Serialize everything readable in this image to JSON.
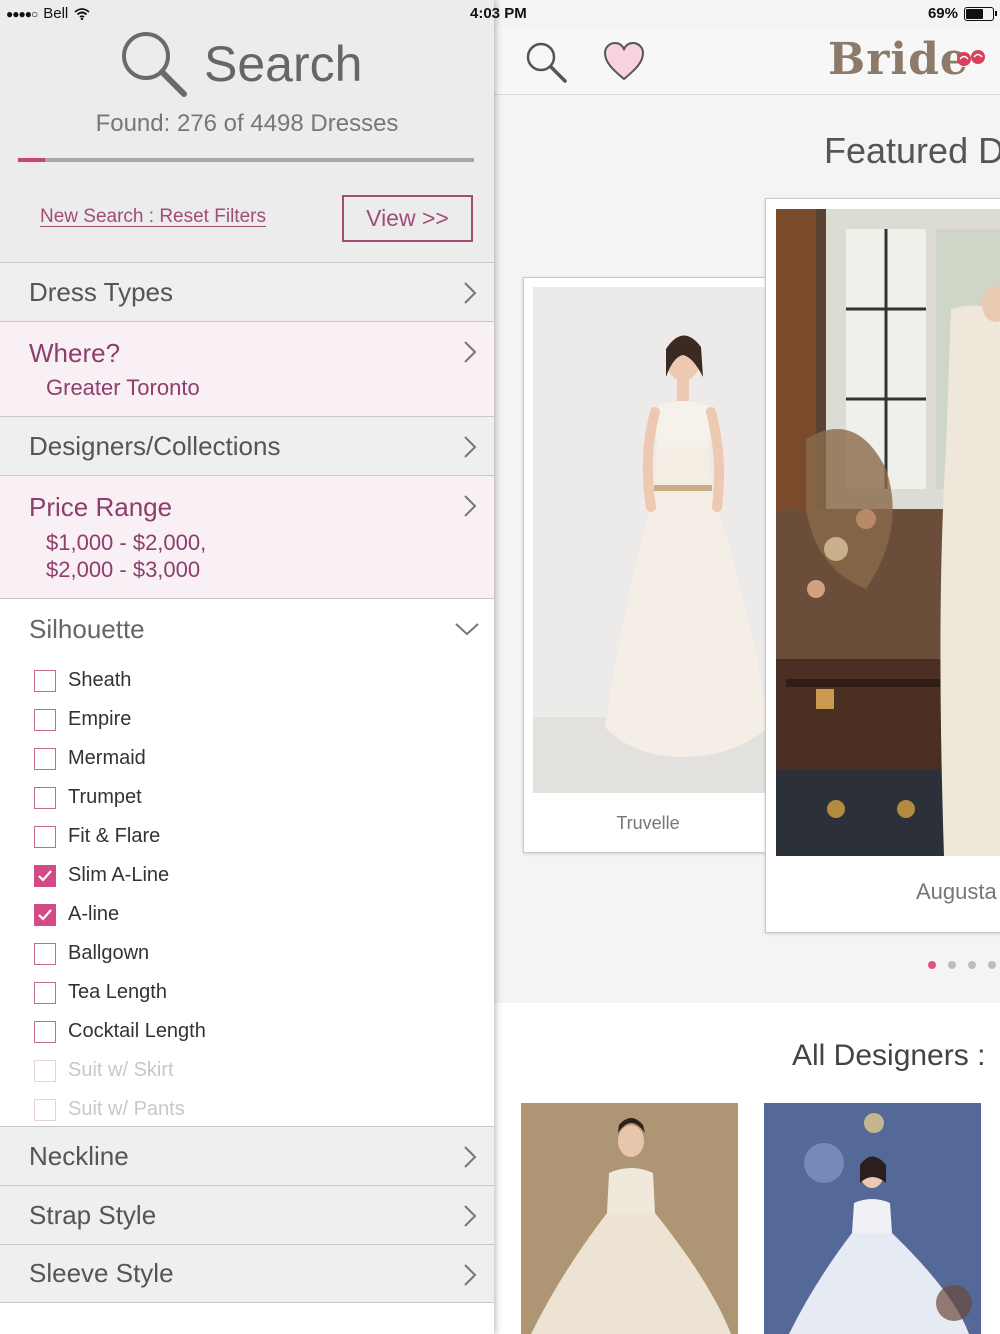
{
  "status_bar": {
    "signal_dots": "●●●●○",
    "carrier": "Bell",
    "time": "4:03 PM",
    "battery_text": "69%",
    "battery_level": 0.69
  },
  "search_panel": {
    "title": "Search",
    "found_text": "Found: 276 of 4498 Dresses",
    "progress": 0.06,
    "new_search_link": "New Search : Reset Filters",
    "view_button": "View >>",
    "filters": {
      "dress_types": "Dress Types",
      "where_label": "Where?",
      "where_value": "Greater Toronto",
      "designers": "Designers/Collections",
      "price_label": "Price Range",
      "price_value_1": "$1,000 - $2,000,",
      "price_value_2": "$2,000 - $3,000",
      "silhouette": "Silhouette",
      "neckline": "Neckline",
      "strap_style": "Strap Style",
      "sleeve_style": "Sleeve Style"
    },
    "silhouette_options": [
      {
        "label": "Sheath",
        "checked": false,
        "enabled": true
      },
      {
        "label": "Empire",
        "checked": false,
        "enabled": true
      },
      {
        "label": "Mermaid",
        "checked": false,
        "enabled": true
      },
      {
        "label": "Trumpet",
        "checked": false,
        "enabled": true
      },
      {
        "label": "Fit & Flare",
        "checked": false,
        "enabled": true
      },
      {
        "label": "Slim A-Line",
        "checked": true,
        "enabled": true
      },
      {
        "label": "A-line",
        "checked": true,
        "enabled": true
      },
      {
        "label": "Ballgown",
        "checked": false,
        "enabled": true
      },
      {
        "label": "Tea Length",
        "checked": false,
        "enabled": true
      },
      {
        "label": "Cocktail Length",
        "checked": false,
        "enabled": true
      },
      {
        "label": "Suit w/ Skirt",
        "checked": false,
        "enabled": false
      },
      {
        "label": "Suit w/ Pants",
        "checked": false,
        "enabled": false
      }
    ]
  },
  "main": {
    "brand": "Bride",
    "featured_title": "Featured D",
    "featured_cards": [
      {
        "caption": "Truvelle"
      },
      {
        "caption": "Augusta"
      }
    ],
    "carousel_active_index": 0,
    "all_designers_title": "All Designers :"
  },
  "colors": {
    "accent": "#c0487b",
    "link": "#a04d77",
    "checkbox_on": "#d34b86",
    "pink_row_bg": "#f9f0f5",
    "brand": "#8c7b6a"
  },
  "icons": {
    "search": "search-icon",
    "heart": "heart-icon",
    "chevron": "chevron-right-icon",
    "chevron_down": "chevron-down-icon",
    "check": "check-icon"
  }
}
